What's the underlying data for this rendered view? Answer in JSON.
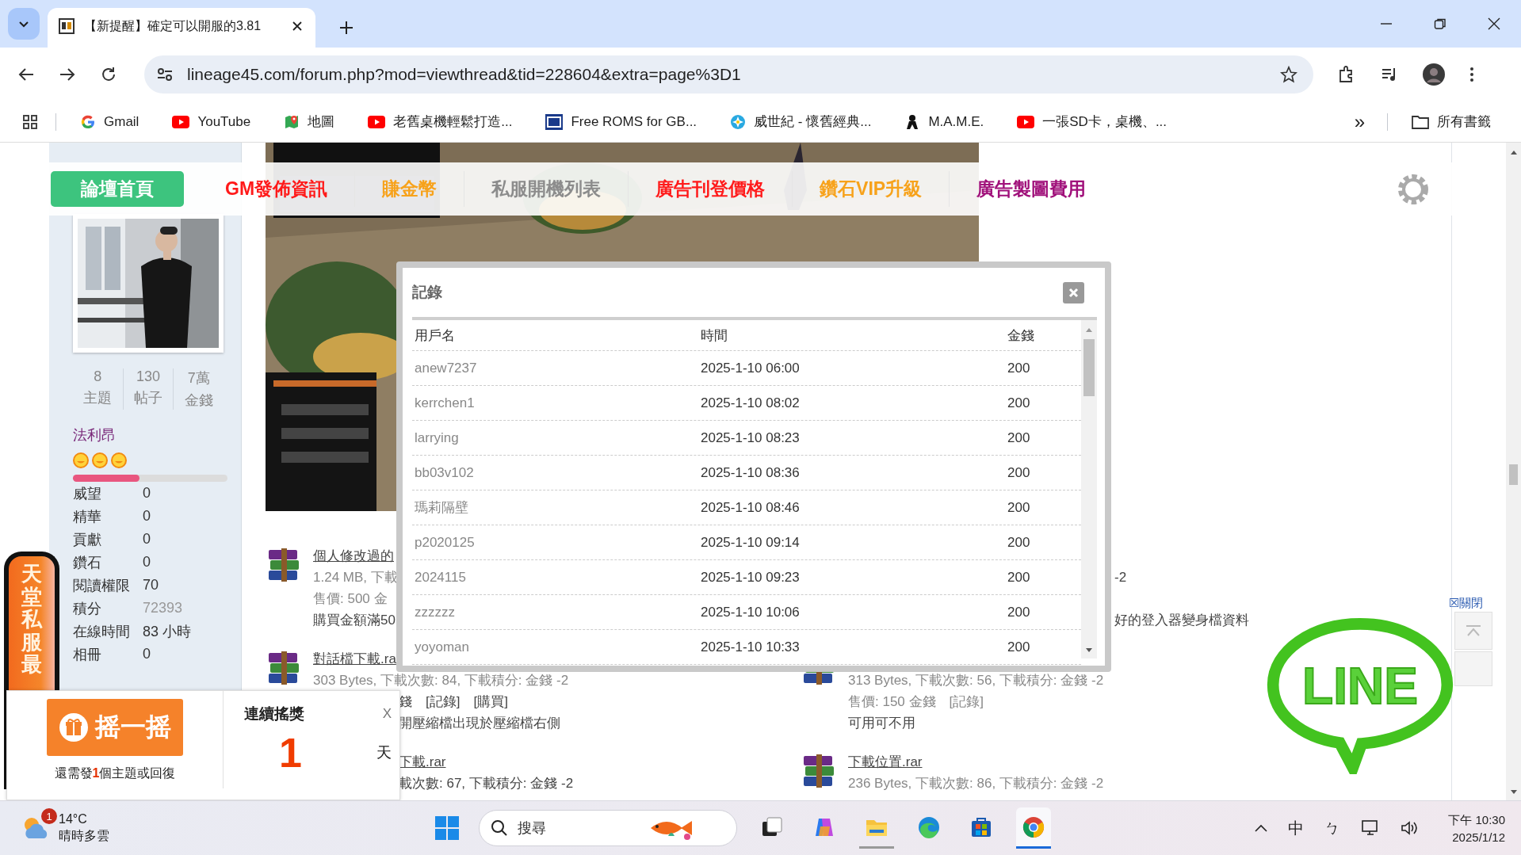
{
  "browser": {
    "tab": {
      "title": "【新提醒】確定可以開服的3.81",
      "selected": true
    },
    "url": "lineage45.com/forum.php?mod=viewthread&tid=228604&extra=page%3D1",
    "bookmarks": [
      {
        "label": "Gmail",
        "kind": "gmail"
      },
      {
        "label": "YouTube",
        "kind": "youtube"
      },
      {
        "label": "地圖",
        "kind": "maps"
      },
      {
        "label": "老舊桌機輕鬆打造...",
        "kind": "youtube"
      },
      {
        "label": "Free ROMS for GB...",
        "kind": "roms"
      },
      {
        "label": "威世紀 - 懷舊經典...",
        "kind": "game"
      },
      {
        "label": "M.A.M.E.",
        "kind": "mame"
      },
      {
        "label": "一張SD卡，桌機、...",
        "kind": "youtube"
      }
    ],
    "more": "»",
    "all_bookmarks": "所有書籤"
  },
  "nav": [
    {
      "label": "論壇首頁",
      "color": "#3dc47e",
      "selected": true
    },
    {
      "label": "GM發佈資訊",
      "color": "#ff1a1a",
      "selected": false
    },
    {
      "label": "賺金幣",
      "color": "#f7a21b",
      "selected": false
    },
    {
      "label": "私服開機列表",
      "color": "#8c8c8c",
      "selected": false
    },
    {
      "label": "廣告刊登價格",
      "color": "#ff1a1a",
      "selected": false
    },
    {
      "label": "鑽石VIP升級",
      "color": "#f7a21b",
      "selected": false
    },
    {
      "label": "廣告製圖費用",
      "color": "#a0107a",
      "selected": false
    }
  ],
  "profile": {
    "stats": [
      {
        "value": "8",
        "label": "主題"
      },
      {
        "value": "130",
        "label": "帖子"
      },
      {
        "value": "7萬",
        "label": "金錢"
      }
    ],
    "group": "法利昂",
    "level": 0.43,
    "fields": [
      {
        "label": "威望",
        "value": "0",
        "kind": "plain"
      },
      {
        "label": "精華",
        "value": "0",
        "kind": "plain"
      },
      {
        "label": "貢獻",
        "value": "0",
        "kind": "plain"
      },
      {
        "label": "鑽石",
        "value": "0",
        "kind": "plain"
      },
      {
        "label": "閱讀權限",
        "value": "70",
        "kind": "plain"
      },
      {
        "label": "積分",
        "value": "72393",
        "kind": "muted"
      },
      {
        "label": "在線時間",
        "value": "83 小時",
        "kind": "plain"
      },
      {
        "label": "相冊",
        "value": "0",
        "kind": "plain"
      }
    ]
  },
  "attachments": {
    "left": [
      {
        "icon": true,
        "lines": [
          {
            "kind": "link",
            "text": "個人修改過的"
          },
          {
            "kind": "info",
            "text": "1.24 MB, 下載"
          },
          {
            "kind": "info",
            "text": "售價: 500 金"
          },
          {
            "kind": "note",
            "text": "購買金額滿50"
          }
        ]
      },
      {
        "icon": true,
        "lines": [
          {
            "kind": "link",
            "text": "對話檔下載.ra"
          },
          {
            "kind": "info",
            "text": "303 Bytes, 下載次數: 84, 下載積分: 金錢 -2"
          },
          {
            "kind": "tail",
            "text": "錢　[記錄]　[購買]"
          },
          {
            "kind": "tail",
            "text": "開壓縮檔出現於壓縮檔右側"
          }
        ]
      },
      {
        "icon": false,
        "lines": [
          {
            "kind": "tail-link",
            "text": "下載.rar"
          },
          {
            "kind": "tail",
            "text": "載次數: 67, 下載積分: 金錢 -2"
          }
        ]
      }
    ],
    "right": [
      {
        "icon": false,
        "lines": [
          {
            "kind": "blank"
          },
          {
            "kind": "tail",
            "text": "-2"
          },
          {
            "kind": "blank"
          },
          {
            "kind": "tail",
            "text": "好的登入器變身檔資料"
          }
        ]
      },
      {
        "icon": true,
        "lines": [
          {
            "kind": "blank"
          },
          {
            "kind": "info",
            "text": "313 Bytes, 下載次數: 56, 下載積分: 金錢 -2"
          },
          {
            "kind": "info",
            "text": "售價: 150 金錢　[記錄]"
          },
          {
            "kind": "note",
            "text": "可用可不用"
          }
        ]
      },
      {
        "icon": true,
        "lines": [
          {
            "kind": "link",
            "text": "下載位置.rar"
          },
          {
            "kind": "info",
            "text": "236 Bytes, 下載次數: 86, 下載積分: 金錢 -2"
          }
        ]
      }
    ]
  },
  "modal": {
    "title": "記錄",
    "columns": [
      "用戶名",
      "時間",
      "金錢"
    ],
    "rows": [
      [
        "anew7237",
        "2025-1-10 06:00",
        "200"
      ],
      [
        "kerrchen1",
        "2025-1-10 08:02",
        "200"
      ],
      [
        "larrying",
        "2025-1-10 08:23",
        "200"
      ],
      [
        "bb03v102",
        "2025-1-10 08:36",
        "200"
      ],
      [
        "瑪莉隔壁",
        "2025-1-10 08:46",
        "200"
      ],
      [
        "p2020125",
        "2025-1-10 09:14",
        "200"
      ],
      [
        "2024115",
        "2025-1-10 09:23",
        "200"
      ],
      [
        "zzzzzz",
        "2025-1-10 10:06",
        "200"
      ],
      [
        "yoyoman",
        "2025-1-10 10:33",
        "200"
      ]
    ]
  },
  "side_tab": "天堂私服最",
  "shake": {
    "button": "摇一摇",
    "note": "還需發**1**個主題或回復",
    "title": "連續搖獎",
    "close": "X",
    "days": "1",
    "unit": "天"
  },
  "right_float": {
    "close": "☒關閉",
    "logo": "LINE"
  },
  "taskbar": {
    "weather": {
      "badge": "1",
      "temp": "14°C",
      "desc": "晴時多雲"
    },
    "search": {
      "placeholder": "搜尋"
    },
    "apps": [
      {
        "kind": "taskview",
        "running": false,
        "selected": false
      },
      {
        "kind": "copilot",
        "running": false,
        "selected": false
      },
      {
        "kind": "files",
        "running": true,
        "selected": false
      },
      {
        "kind": "edge",
        "running": false,
        "selected": false
      },
      {
        "kind": "store",
        "running": false,
        "selected": false
      },
      {
        "kind": "chrome",
        "running": true,
        "selected": true
      }
    ],
    "ime": "中",
    "bopomofo": "ㄅ",
    "time": "下午 10:30",
    "date": "2025/1/12"
  }
}
